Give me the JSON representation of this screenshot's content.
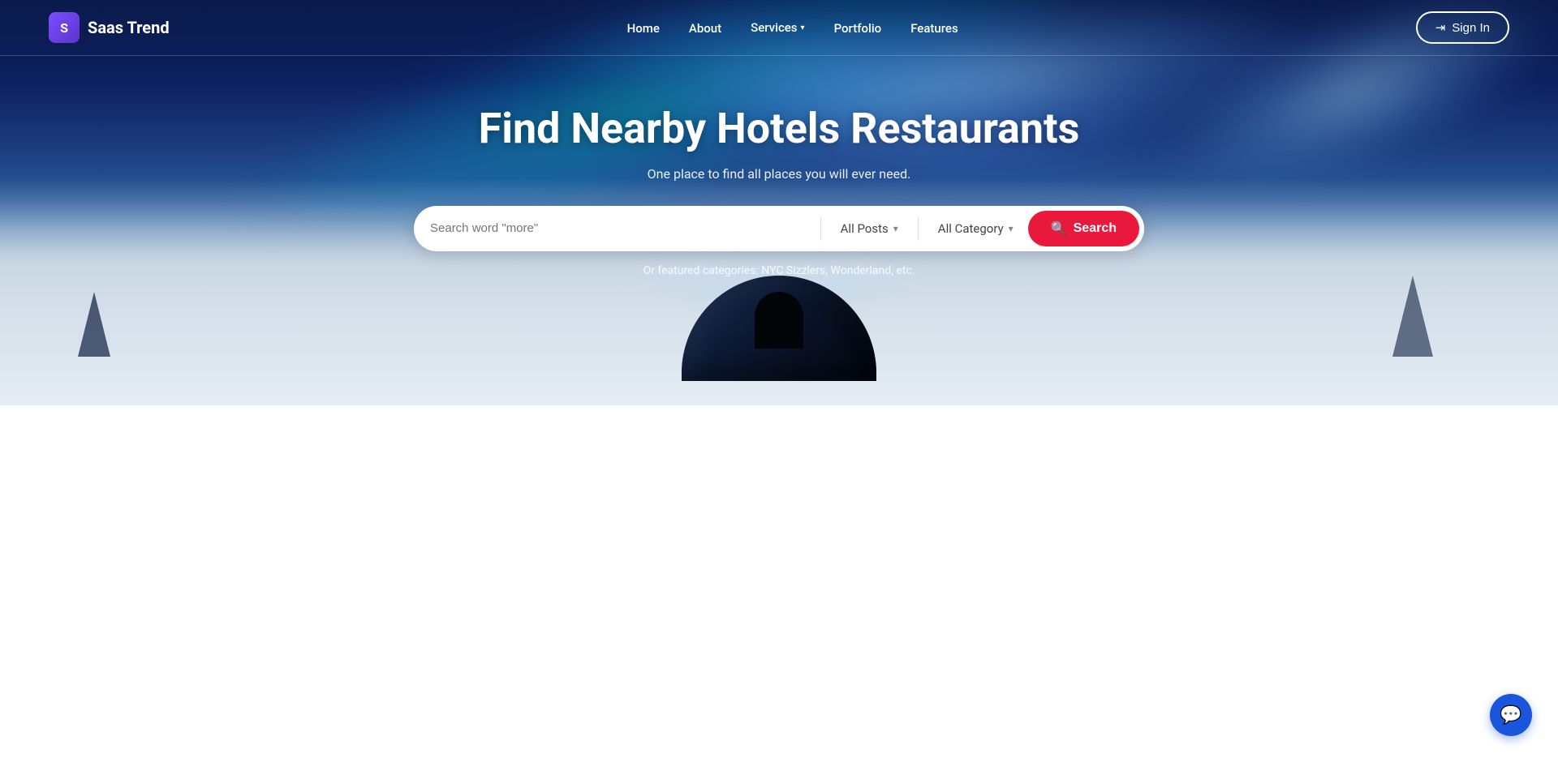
{
  "brand": {
    "logo_letter": "S",
    "name": "Saas Trend"
  },
  "nav": {
    "items": [
      {
        "label": "Home",
        "has_dropdown": false
      },
      {
        "label": "About",
        "has_dropdown": false
      },
      {
        "label": "Services",
        "has_dropdown": true
      },
      {
        "label": "Portfolio",
        "has_dropdown": false
      },
      {
        "label": "Features",
        "has_dropdown": false
      }
    ],
    "sign_in": "Sign In"
  },
  "hero": {
    "title": "Find Nearby Hotels Restaurants",
    "subtitle": "One place to find all places you will ever need.",
    "search_placeholder": "Search word \"more\"",
    "posts_dropdown": "All Posts",
    "category_dropdown": "All Category",
    "search_button": "Search",
    "featured_text": "Or featured categories: NYC Sizzlers, Wonderland, etc."
  },
  "colors": {
    "brand_purple": "#7c4dff",
    "search_red": "#e8193c",
    "nav_blue": "#1a56db"
  }
}
